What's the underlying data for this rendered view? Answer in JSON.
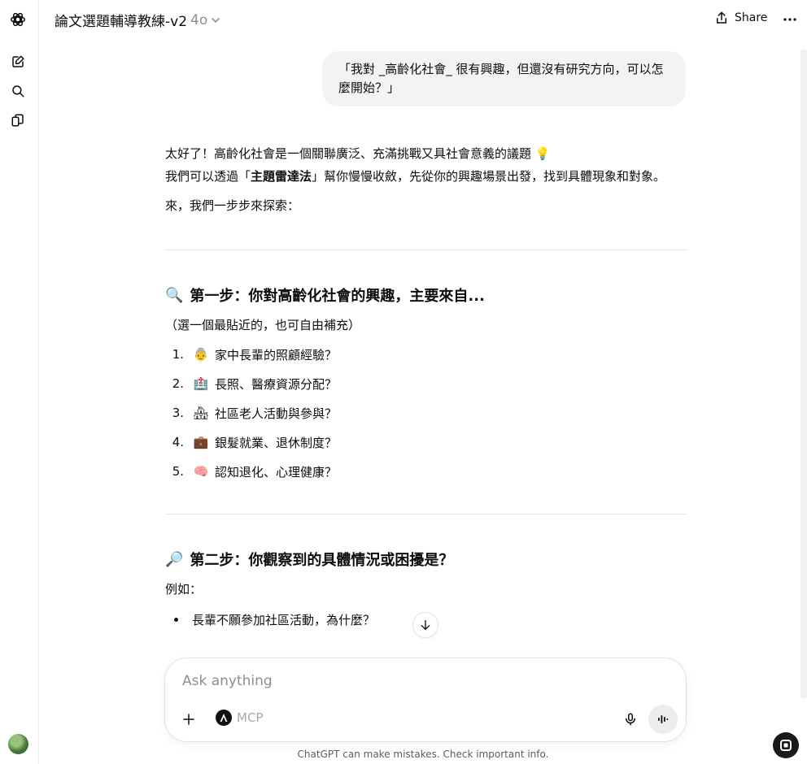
{
  "header": {
    "title": "論文選題輔導教練-v2",
    "model": "4o",
    "share_label": "Share"
  },
  "sidebar": {
    "icons": [
      "chatgpt-logo-icon",
      "new-chat-icon",
      "search-icon",
      "library-icon"
    ]
  },
  "user_message": "「我對 _高齡化社會_ 很有興趣，但還沒有研究方向，可以怎麼開始？」",
  "assistant": {
    "intro_line1": "太好了！高齡化社會是一個關聯廣泛、充滿挑戰又具社會意義的議題 💡",
    "intro_line2_pre": "我們可以透過「",
    "intro_line2_bold": "主題雷達法",
    "intro_line2_post": "」幫你慢慢收斂，先從你的興趣場景出發，找到具體現象和對象。",
    "intro_line3": "來，我們一步步來探索：",
    "step1": {
      "emoji": "🔍",
      "title": "第一步：你對高齡化社會的興趣，主要來自...",
      "hint": "（選一個最貼近的，也可自由補充）",
      "items": [
        {
          "num": "1.",
          "emoji": "👵",
          "text": "家中長輩的照顧經驗？"
        },
        {
          "num": "2.",
          "emoji": "🏥",
          "text": "長照、醫療資源分配？"
        },
        {
          "num": "3.",
          "emoji": "🏘",
          "text": "社區老人活動與參與？"
        },
        {
          "num": "4.",
          "emoji": "💼",
          "text": "銀髮就業、退休制度？"
        },
        {
          "num": "5.",
          "emoji": "🧠",
          "text": "認知退化、心理健康？"
        }
      ]
    },
    "step2": {
      "emoji": "🔎",
      "title": "第二步：你觀察到的具體情況或困擾是？",
      "hint": "例如：",
      "items": [
        "長輩不願參加社區活動，為什麼？"
      ]
    }
  },
  "composer": {
    "placeholder": "Ask anything",
    "mcp_label": "MCP"
  },
  "disclaimer": "ChatGPT can make mistakes. Check important info."
}
